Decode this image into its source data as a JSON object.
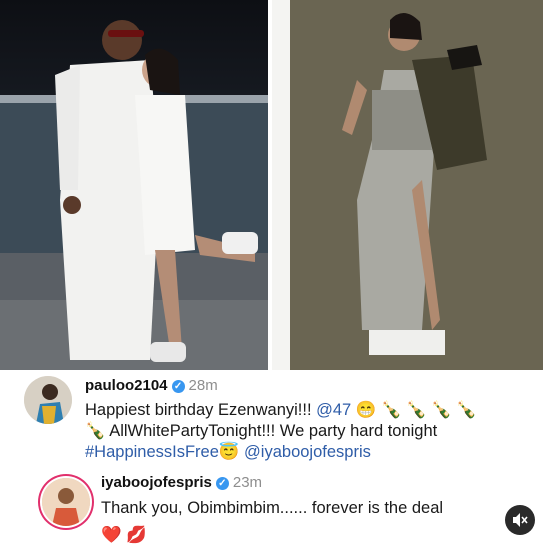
{
  "comments": [
    {
      "username": "pauloo2104",
      "time": "28m",
      "line1_text": "Happiest birthday Ezenwanyi!!! ",
      "line1_mention": "@47",
      "line1_emojis": "😁 🍾 🍾 🍾 🍾",
      "line2_emoji": "🍾",
      "line2_text": " AllWhitePartyTonight!!! We party hard tonight",
      "line3_hashtag": "#HappinessIsFree",
      "line3_emoji": "😇",
      "line3_mention": "@iyaboojofespris"
    },
    {
      "username": "iyaboojofespris",
      "time": "23m",
      "line1_text": "Thank you, Obimbimbim...... forever is the deal",
      "line2_emojis": "❤️ 💋"
    }
  ],
  "icons": {
    "verified": "verified-badge-icon",
    "mute": "speaker-muted-icon"
  },
  "colors": {
    "verified": "#3897f0",
    "link": "#2f5da8",
    "story_ring": "#e1306c"
  }
}
